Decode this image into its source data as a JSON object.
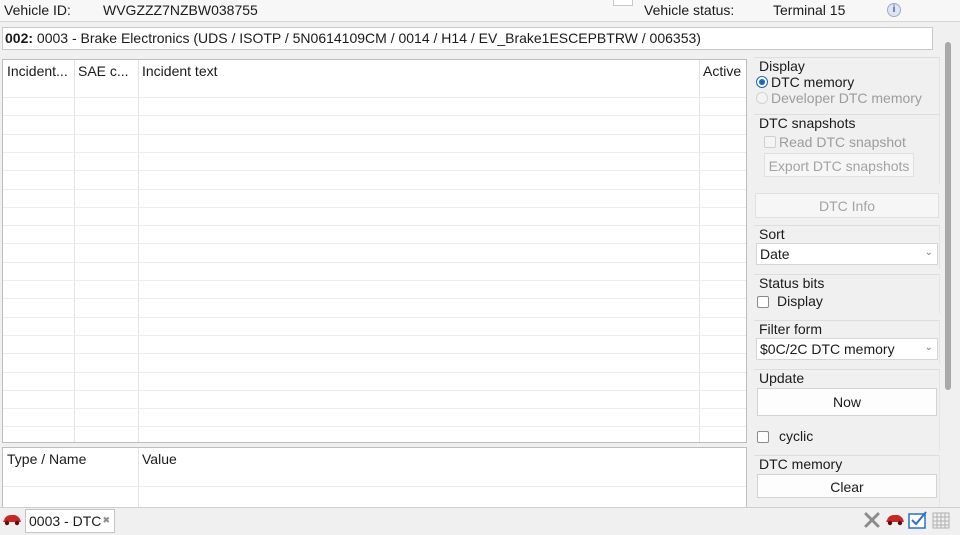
{
  "vehicle": {
    "id_label": "Vehicle ID:",
    "id_value": "WVGZZZ7NZBW038755",
    "status_label": "Vehicle status:",
    "status_value": "Terminal 15"
  },
  "ecu": {
    "number": "002:",
    "description": "0003 - Brake Electronics  (UDS / ISOTP / 5N0614109CM / 0014 / H14 / EV_Brake1ESCEPBTRW / 006353)"
  },
  "incident_table": {
    "columns": [
      "Incident...",
      "SAE c...",
      "Incident text",
      "Active"
    ]
  },
  "detail_table": {
    "columns": [
      "Type / Name",
      "Value"
    ]
  },
  "panel": {
    "display": {
      "title": "Display",
      "option_dtc_memory": "DTC memory",
      "option_developer": "Developer DTC memory",
      "selected": "DTC memory"
    },
    "snapshots": {
      "title": "DTC snapshots",
      "read_label": "Read DTC snapshot",
      "export_label": "Export DTC snapshots"
    },
    "dtc_info_label": "DTC Info",
    "sort": {
      "title": "Sort",
      "selected": "Date"
    },
    "status_bits": {
      "title": "Status bits",
      "display_label": "Display"
    },
    "filter_form": {
      "title": "Filter form",
      "selected": "$0C/2C DTC memory"
    },
    "update": {
      "title": "Update",
      "now_label": "Now",
      "cyclic_label": "cyclic"
    },
    "dtc_memory": {
      "title": "DTC memory",
      "clear_label": "Clear"
    }
  },
  "bottom": {
    "tab_label": "0003 - DTC"
  },
  "colors": {
    "accent": "#1a66c4",
    "car": "#c62828",
    "tool_blue": "#2f6fc9"
  },
  "icons": [
    "info-icon",
    "car-icon",
    "close-x-icon",
    "checklist-icon",
    "grid-icon"
  ]
}
